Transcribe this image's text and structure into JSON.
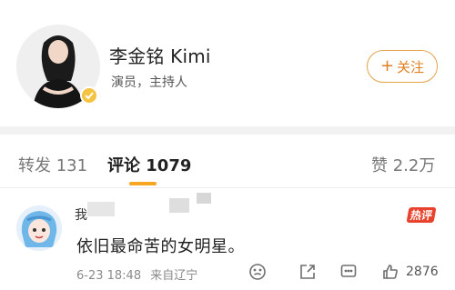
{
  "profile": {
    "name": "李金铭 Kimi",
    "subtitle": "演员，主持人",
    "follow_label": "关注"
  },
  "tabs": {
    "repost": "转发 131",
    "comments": "评论 1079",
    "likes": "赞 2.2万"
  },
  "comment": {
    "user_name": "我",
    "hot_badge": "热评",
    "text": "依旧最命苦的女明星。",
    "time": "6-23 18:48",
    "location": "来自辽宁",
    "like_count": "2876"
  },
  "colors": {
    "accent": "#f5a623",
    "follow_border": "#e2a34a",
    "follow_text": "#e07f1f",
    "hot_badge_bg": "#e8412c"
  }
}
